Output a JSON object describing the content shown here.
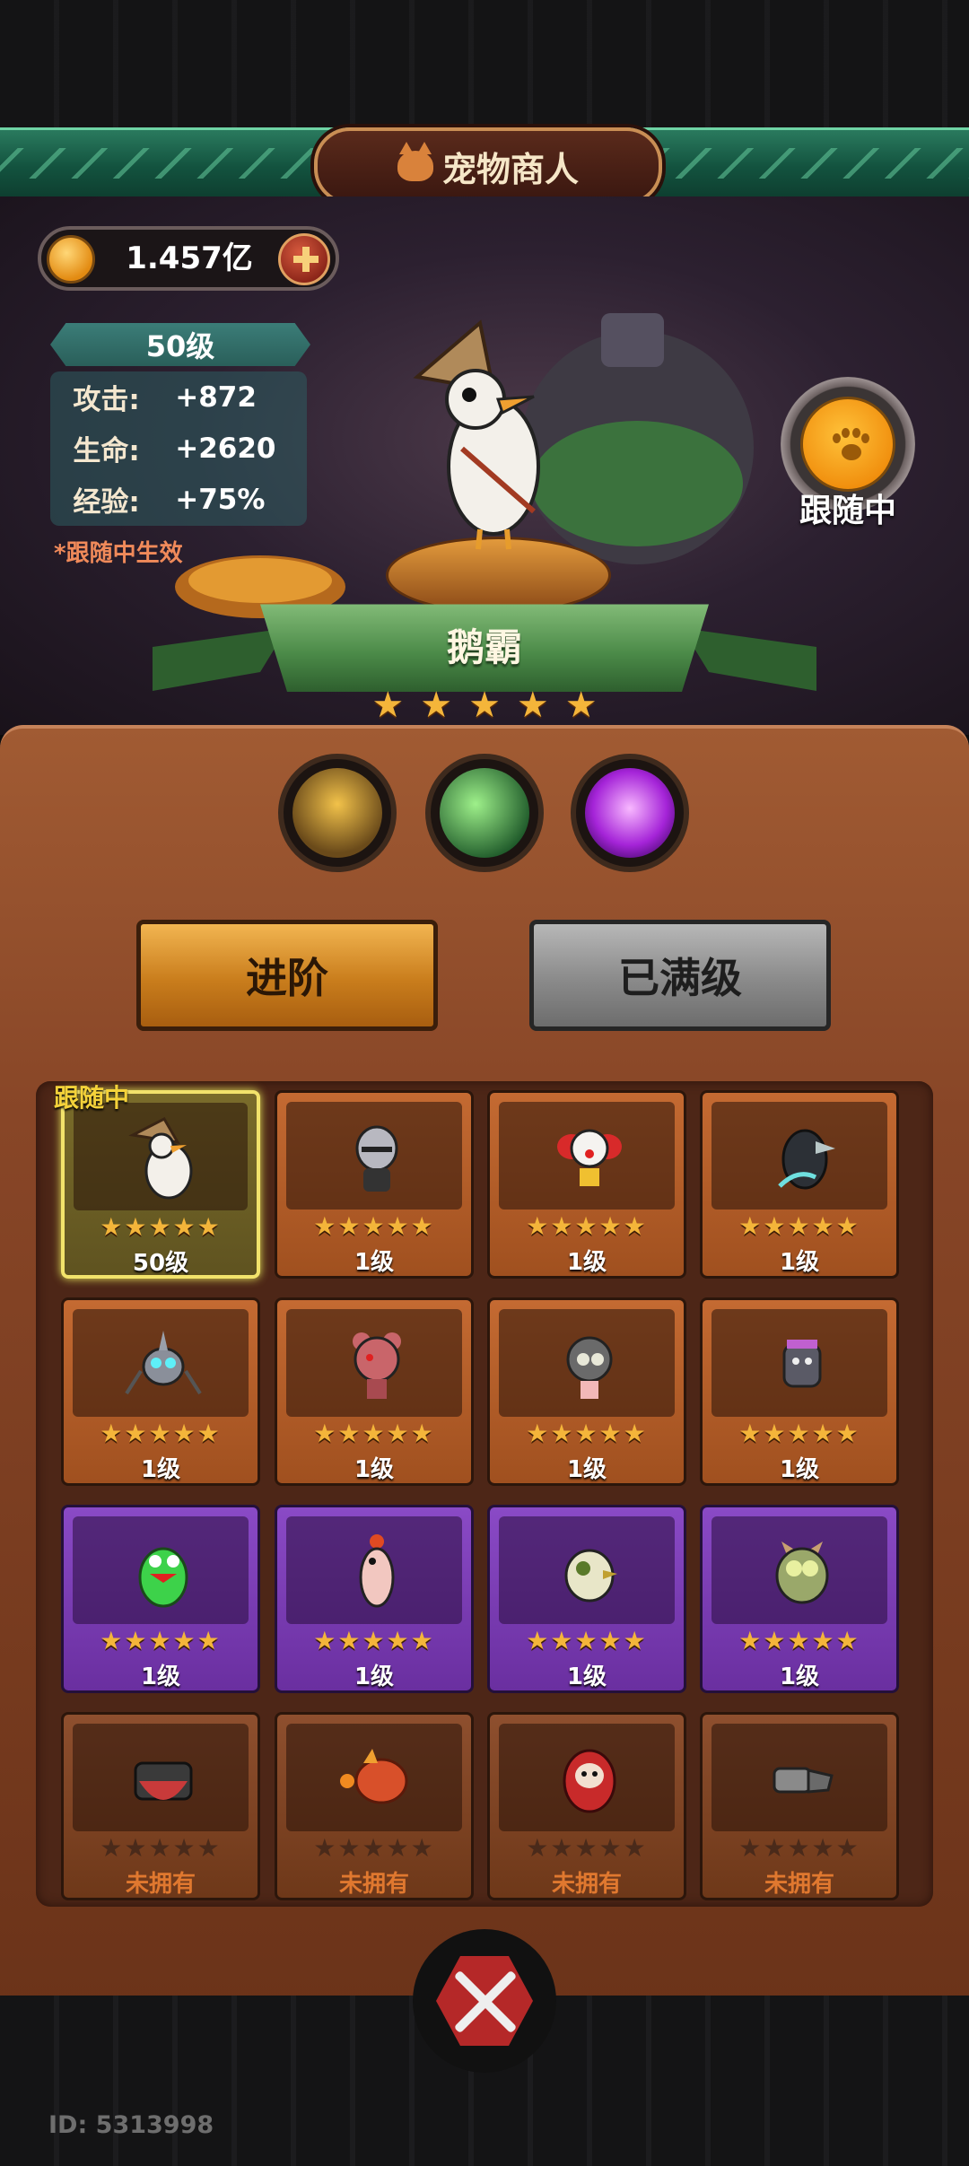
{
  "header": {
    "title": "宠物商人"
  },
  "currency": {
    "value": "1.457亿"
  },
  "stats": {
    "level": "50级",
    "rows": [
      {
        "label": "攻击:",
        "value": "+872"
      },
      {
        "label": "生命:",
        "value": "+2620"
      },
      {
        "label": "经验:",
        "value": "+75%"
      }
    ],
    "note": "*跟随中生效"
  },
  "follow": {
    "label": "跟随中"
  },
  "pet": {
    "name": "鹅霸",
    "stars": 5
  },
  "buttons": {
    "advance": "进阶",
    "max_level": "已满级"
  },
  "grid": {
    "following_tag": "跟随中",
    "cards": [
      {
        "level": "50级",
        "stars": "★★★★★"
      },
      {
        "level": "1级",
        "stars": "★★★★★"
      },
      {
        "level": "1级",
        "stars": "★★★★★"
      },
      {
        "level": "1级",
        "stars": "★★★★★"
      },
      {
        "level": "1级",
        "stars": "★★★★★"
      },
      {
        "level": "1级",
        "stars": "★★★★★"
      },
      {
        "level": "1级",
        "stars": "★★★★★"
      },
      {
        "level": "1级",
        "stars": "★★★★★"
      },
      {
        "level": "1级",
        "stars": "★★★★★"
      },
      {
        "level": "1级",
        "stars": "★★★★★"
      },
      {
        "level": "1级",
        "stars": "★★★★★"
      },
      {
        "level": "1级",
        "stars": "★★★★★"
      },
      {
        "level": "未拥有",
        "stars": "★★★★★"
      },
      {
        "level": "未拥有",
        "stars": "★★★★★"
      },
      {
        "level": "未拥有",
        "stars": "★★★★★"
      },
      {
        "level": "未拥有",
        "stars": "★★★★★"
      }
    ]
  },
  "footer": {
    "player_id": "ID: 5313998"
  }
}
